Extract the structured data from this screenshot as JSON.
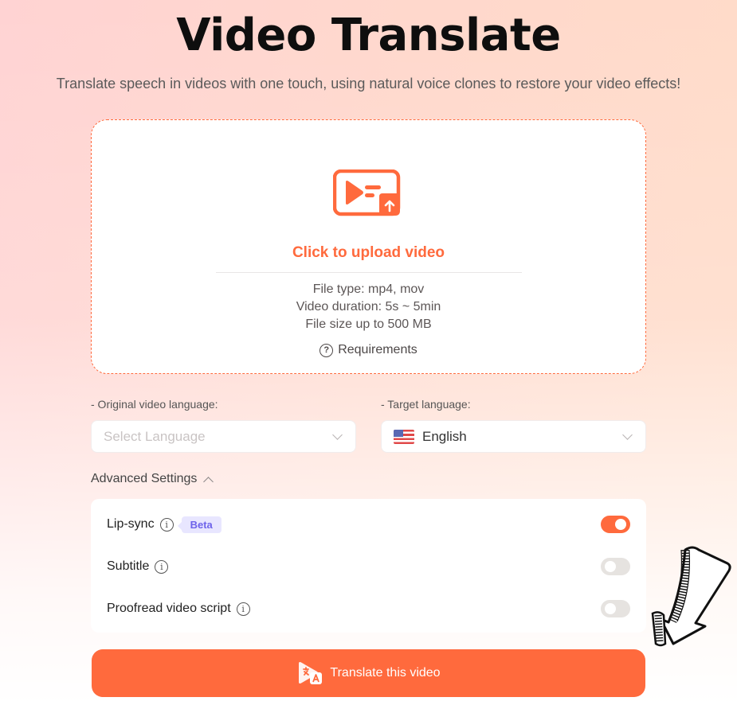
{
  "header": {
    "title": "Video Translate",
    "subtitle": "Translate speech in videos with one touch, using natural voice clones to restore your video effects!"
  },
  "upload": {
    "icon": "video-upload-icon",
    "cta": "Click to upload video",
    "info": [
      "File type: mp4, mov",
      "Video duration: 5s ~ 5min",
      "File size up to 500 MB"
    ],
    "requirements_label": "Requirements",
    "requirements_icon": "question-circle-icon"
  },
  "languages": {
    "original": {
      "label": "- Original video language:",
      "placeholder": "Select Language",
      "value": ""
    },
    "target": {
      "label": "- Target language:",
      "value": "English",
      "flag": "us-flag-icon"
    }
  },
  "advanced": {
    "label": "Advanced Settings",
    "expanded": true,
    "settings": [
      {
        "label": "Lip-sync",
        "badge": "Beta",
        "enabled": true
      },
      {
        "label": "Subtitle",
        "enabled": false
      },
      {
        "label": "Proofread video script",
        "enabled": false
      }
    ]
  },
  "action": {
    "label": "Translate this video",
    "icon": "translate-icon"
  },
  "colors": {
    "accent": "#ff6a3d",
    "badge_bg": "#e8e6ff",
    "badge_text": "#6e63ea",
    "toggle_off": "#e6e3e0"
  }
}
